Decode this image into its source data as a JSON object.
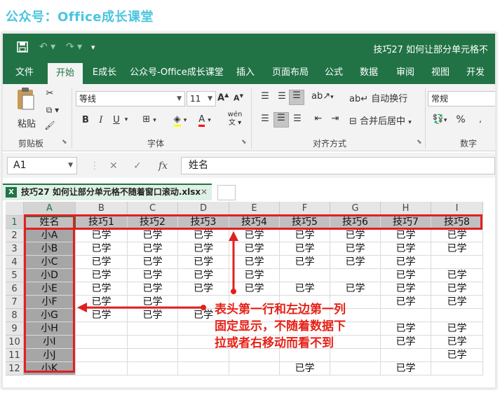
{
  "banner": "公众号：Office成长课堂",
  "titlebar": {
    "title": "技巧27  如何让部分单元格不",
    "icons": [
      "save-icon",
      "undo-icon",
      "redo-icon",
      "customize-icon"
    ]
  },
  "tabs": [
    "文件",
    "开始",
    "E成长",
    "公众号-Office成长课堂",
    "插入",
    "页面布局",
    "公式",
    "数据",
    "审阅",
    "视图",
    "开发"
  ],
  "ribbon": {
    "clipboard": {
      "paste": "粘贴",
      "label": "剪贴板"
    },
    "font": {
      "name": "等线",
      "size": "11",
      "bold": "B",
      "italic": "I",
      "underline": "U",
      "grow": "A",
      "shrink": "A",
      "font_color": "A",
      "wen": "wén",
      "label": "字体"
    },
    "alignment": {
      "wrap": "自动换行",
      "merge": "合并后居中",
      "label": "对齐方式"
    },
    "number": {
      "format": "常规",
      "percent": "%",
      "label": "数字"
    }
  },
  "formula_bar": {
    "cell_ref": "A1",
    "fx": "fx",
    "content": "姓名"
  },
  "workbook": {
    "tab_label": "技巧27  如何让部分单元格不随着窗口滚动.xlsx",
    "icon_text": "X"
  },
  "grid": {
    "columns": [
      "A",
      "B",
      "C",
      "D",
      "E",
      "F",
      "G",
      "H",
      "I"
    ],
    "row_numbers": [
      "1",
      "2",
      "3",
      "4",
      "5",
      "6",
      "7",
      "8",
      "9",
      "10",
      "11",
      "12"
    ],
    "rows": [
      [
        "姓名",
        "技巧1",
        "技巧2",
        "技巧3",
        "技巧4",
        "技巧5",
        "技巧6",
        "技巧7",
        "技巧8"
      ],
      [
        "小A",
        "已学",
        "已学",
        "已学",
        "已学",
        "已学",
        "已学",
        "已学",
        "已学"
      ],
      [
        "小B",
        "已学",
        "已学",
        "已学",
        "已学",
        "已学",
        "已学",
        "已学",
        "已学"
      ],
      [
        "小C",
        "已学",
        "已学",
        "已学",
        "已学",
        "已学",
        "已学",
        "已学",
        ""
      ],
      [
        "小D",
        "已学",
        "已学",
        "已学",
        "已学",
        "",
        "",
        "已学",
        "已学"
      ],
      [
        "小E",
        "已学",
        "已学",
        "已学",
        "已学",
        "已学",
        "已学",
        "已学",
        "已学"
      ],
      [
        "小F",
        "已学",
        "已学",
        "",
        "",
        "",
        "",
        "已学",
        "已学"
      ],
      [
        "小G",
        "已学",
        "已学",
        "已学",
        "",
        "",
        "",
        "",
        ""
      ],
      [
        "小H",
        "",
        "",
        "",
        "",
        "",
        "",
        "已学",
        "已学"
      ],
      [
        "小I",
        "",
        "",
        "",
        "",
        "",
        "",
        "已学",
        "已学"
      ],
      [
        "小J",
        "",
        "",
        "",
        "",
        "",
        "",
        "",
        "已学"
      ],
      [
        "小K",
        "",
        "",
        "",
        "",
        "已学",
        "",
        "已学",
        ""
      ]
    ]
  },
  "annotation": {
    "lines": [
      "表头第一行和左边第一列",
      "固定显示，不随着数据下",
      "拉或者右移动而看不到"
    ],
    "color": "#e62117"
  },
  "colors": {
    "excel_green": "#217346",
    "banner": "#49c5de",
    "highlight": "#e02020"
  }
}
